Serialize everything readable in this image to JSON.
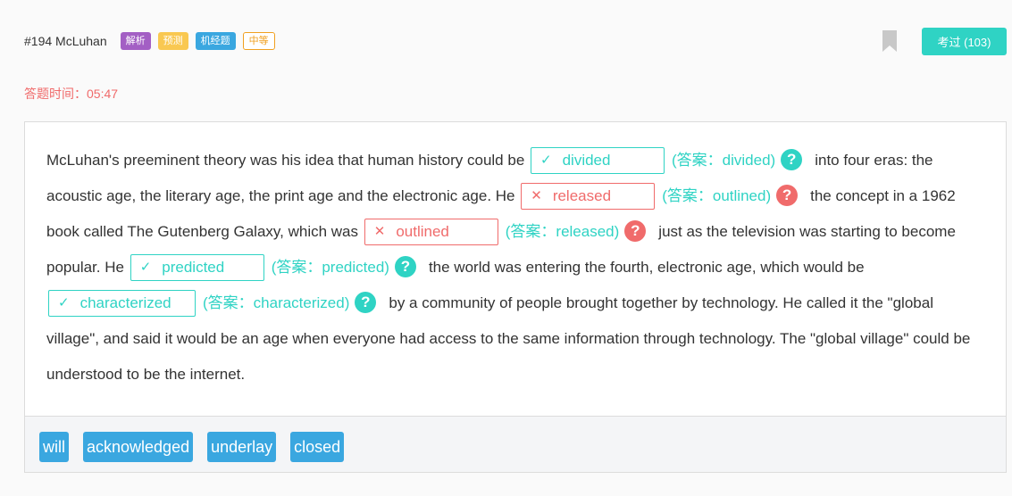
{
  "header": {
    "question_title": "#194 McLuhan",
    "tags": [
      "解析",
      "预测",
      "机经题"
    ],
    "difficulty": "中等",
    "submit_button": "考过 (103)"
  },
  "timer": {
    "label": "答题时间：",
    "value": "05:47"
  },
  "passage": {
    "segments": [
      "McLuhan's preeminent theory was his idea that human history could be",
      "into four eras: the acoustic age, the literary age, the print age and the electronic age. He",
      "the concept in a 1962 book called The Gutenberg Galaxy, which was",
      "just as the television was starting to become popular. He",
      "the world was entering the fourth, electronic age, which would be",
      "by a community of people brought together by technology. He called it the \"global village\", and said it would be an age when everyone had access to the same information through technology. The \"global village\" could be understood to be the internet."
    ],
    "blanks": [
      {
        "user_answer": "divided",
        "correct": true,
        "answer_label": "(答案：divided)"
      },
      {
        "user_answer": "released",
        "correct": false,
        "answer_label": "(答案：outlined)"
      },
      {
        "user_answer": "outlined",
        "correct": false,
        "answer_label": "(答案：released)"
      },
      {
        "user_answer": "predicted",
        "correct": true,
        "answer_label": "(答案：predicted)"
      },
      {
        "user_answer": "characterized",
        "correct": true,
        "answer_label": "(答案：characterized)"
      }
    ]
  },
  "word_bank": [
    "will",
    "acknowledged",
    "underlay",
    "closed"
  ],
  "colors": {
    "correct": "#2fd3c4",
    "wrong": "#f06b6b",
    "word_bank": "#3aa7e0",
    "tag_explain": "#a35fc4",
    "tag_predict": "#f9c851",
    "tag_machine": "#3aa7e0",
    "difficulty": "#f0a020"
  },
  "icons": {
    "correct": "check-icon",
    "wrong": "cross-icon",
    "help": "question-icon",
    "bookmark": "bookmark-icon"
  }
}
